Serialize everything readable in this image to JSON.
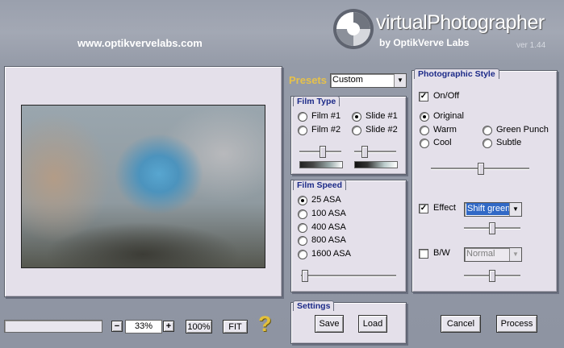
{
  "header": {
    "url": "www.optikvervelabs.com",
    "app_name": "virtualPhotographer",
    "by_label": "by OptikVerve Labs",
    "version": "ver 1.44"
  },
  "presets": {
    "label": "Presets",
    "selected": "Custom"
  },
  "film_type": {
    "title": "Film Type",
    "options": [
      {
        "label": "Film #1",
        "selected": false
      },
      {
        "label": "Slide #1",
        "selected": true
      },
      {
        "label": "Film #2",
        "selected": false
      },
      {
        "label": "Slide #2",
        "selected": false
      }
    ],
    "slider_left": 0.55,
    "slider_right": 0.2
  },
  "film_speed": {
    "title": "Film Speed",
    "options": [
      {
        "label": "25 ASA",
        "selected": true
      },
      {
        "label": "100 ASA",
        "selected": false
      },
      {
        "label": "400 ASA",
        "selected": false
      },
      {
        "label": "800 ASA",
        "selected": false
      },
      {
        "label": "1600 ASA",
        "selected": false
      }
    ],
    "slider": 0.0
  },
  "photographic_style": {
    "title": "Photographic Style",
    "onoff_label": "On/Off",
    "onoff_checked": true,
    "styles": [
      {
        "label": "Original",
        "selected": true
      },
      {
        "label": "Warm",
        "selected": false
      },
      {
        "label": "Green Punch",
        "selected": false
      },
      {
        "label": "Cool",
        "selected": false
      },
      {
        "label": "Subtle",
        "selected": false
      }
    ],
    "style_slider": 0.5,
    "effect_label": "Effect",
    "effect_checked": true,
    "effect_value": "Shift green",
    "effect_slider": 0.5,
    "bw_label": "B/W",
    "bw_checked": false,
    "bw_value": "Normal",
    "bw_slider": 0.5
  },
  "settings": {
    "title": "Settings",
    "save_label": "Save",
    "load_label": "Load"
  },
  "zoom": {
    "minus_label": "−",
    "value": "33%",
    "plus_label": "+",
    "hundred_label": "100%",
    "fit_label": "FIT",
    "help_label": "?"
  },
  "actions": {
    "cancel_label": "Cancel",
    "process_label": "Process"
  }
}
